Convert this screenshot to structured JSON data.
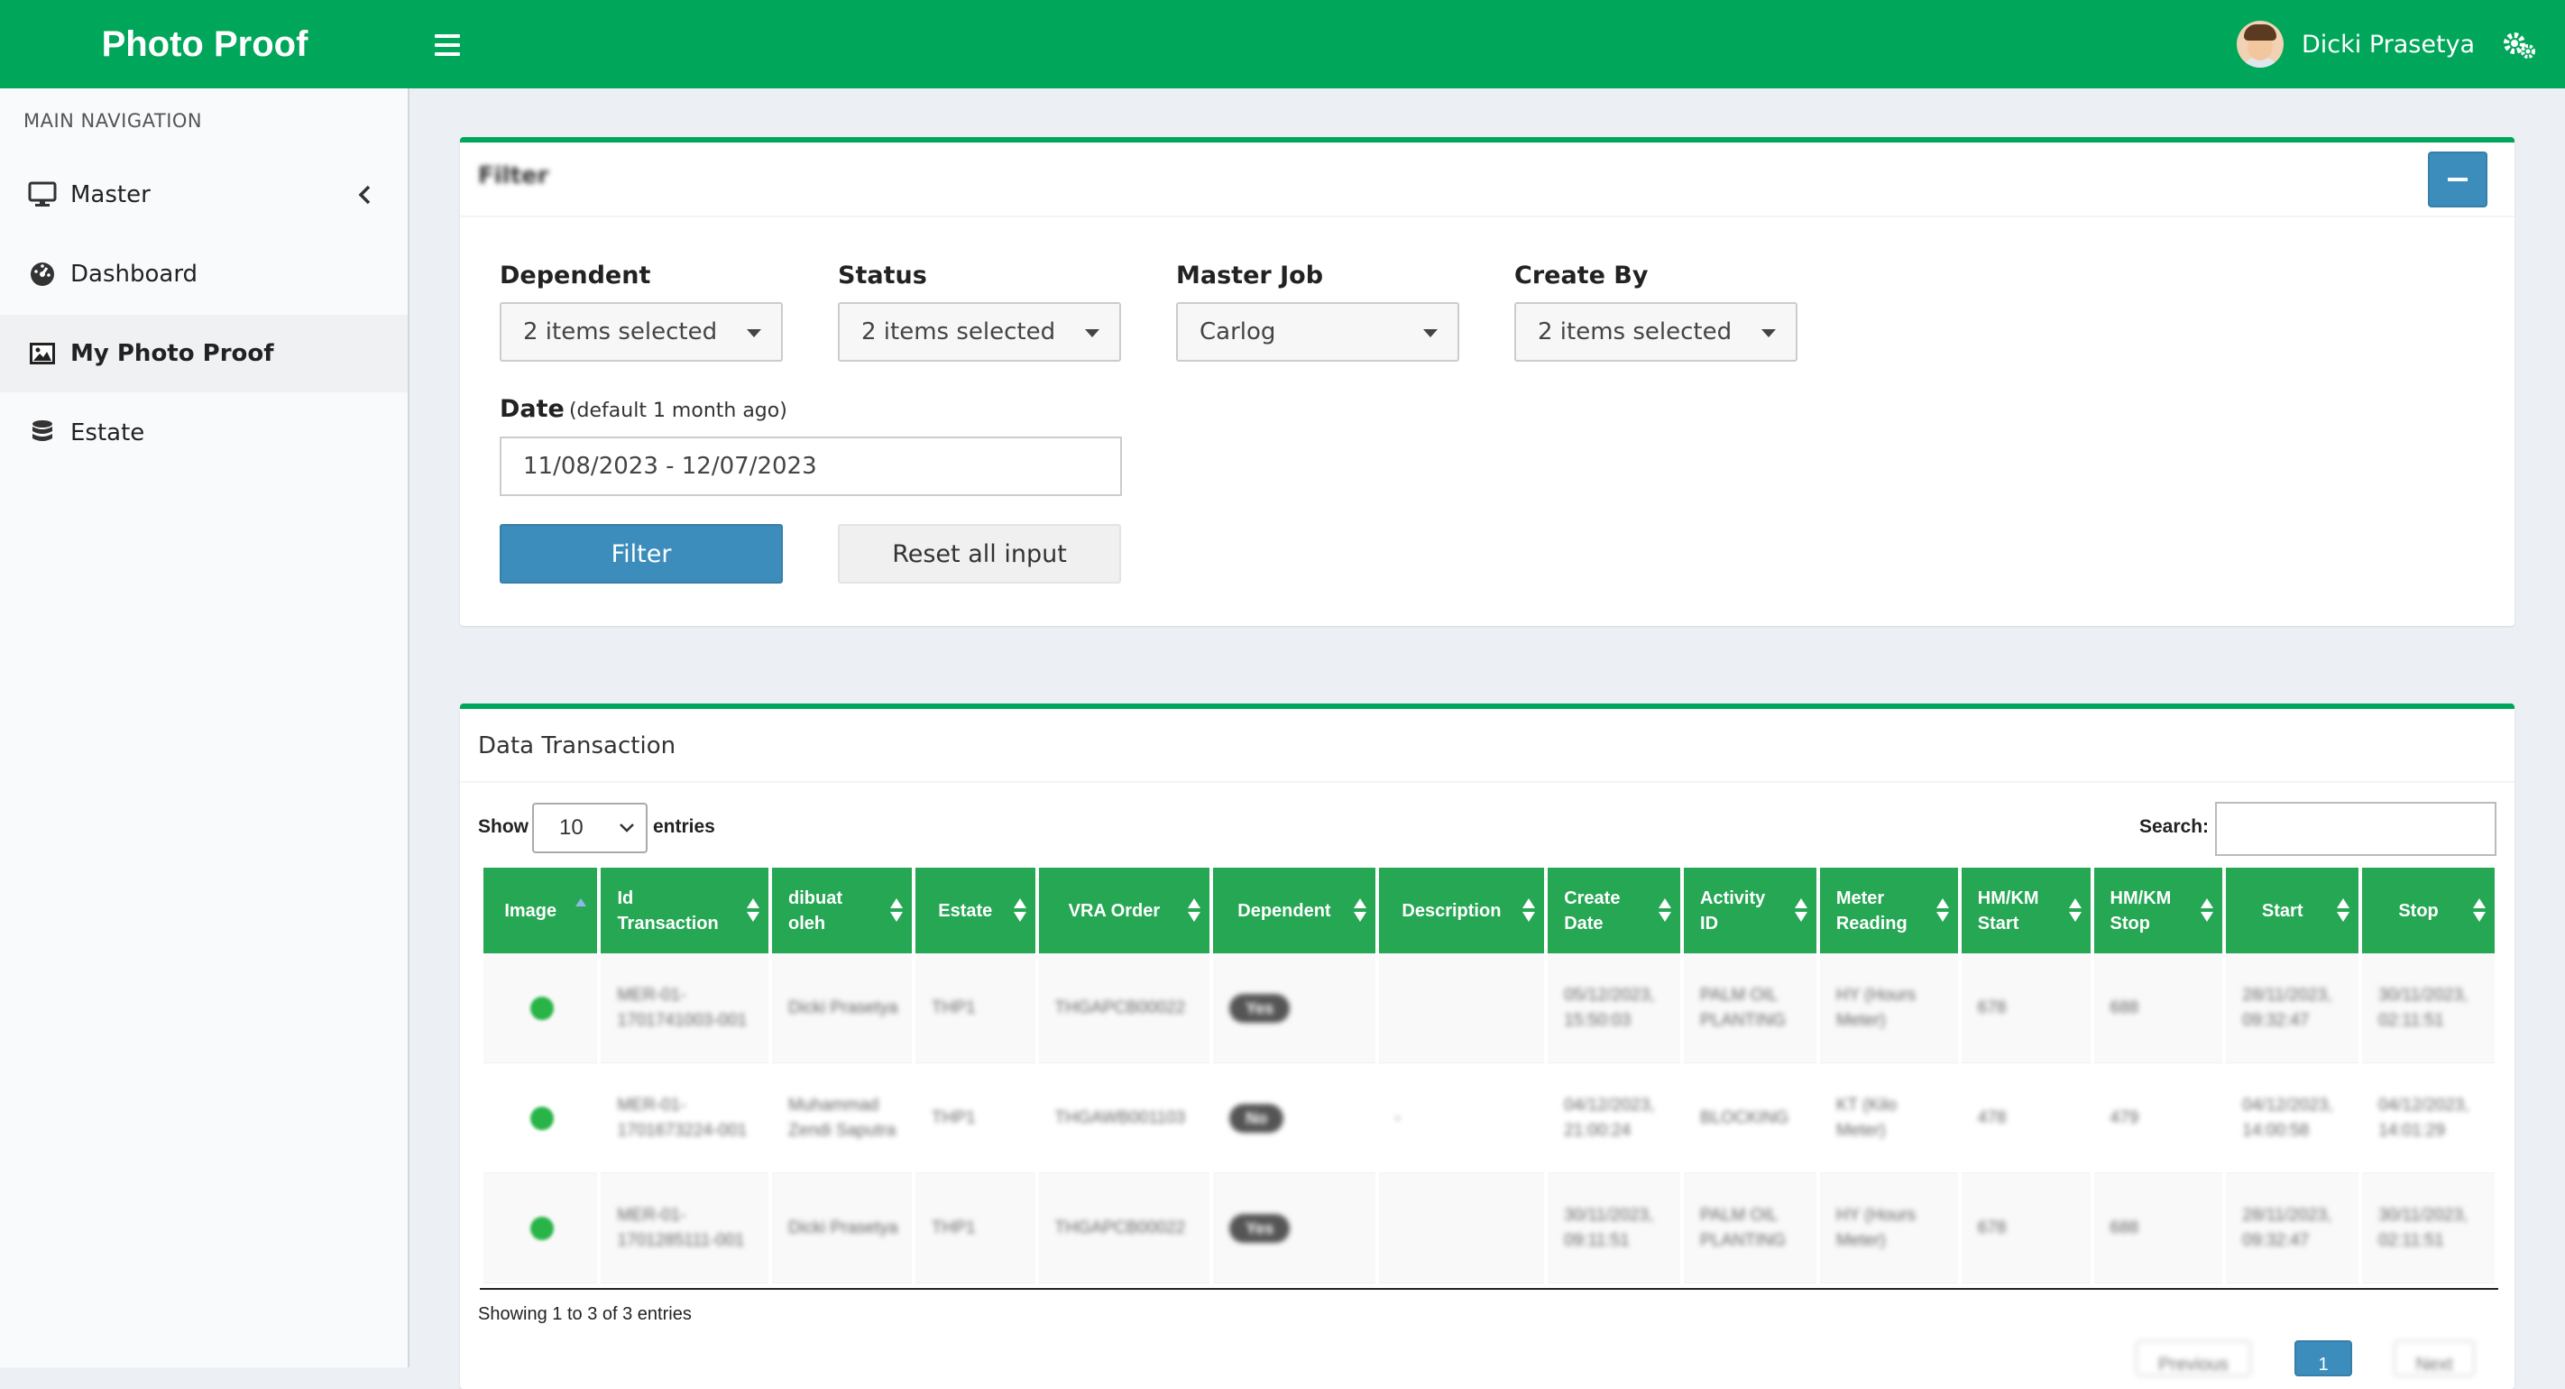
{
  "app": {
    "title": "Photo Proof"
  },
  "header": {
    "user_name": "Dicki Prasetya"
  },
  "sidebar": {
    "heading": "MAIN NAVIGATION",
    "items": [
      {
        "label": "Master",
        "icon": "monitor-icon"
      },
      {
        "label": "Dashboard",
        "icon": "dashboard-icon"
      },
      {
        "label": "My Photo Proof",
        "icon": "image-icon",
        "active": true
      },
      {
        "label": "Estate",
        "icon": "database-icon"
      }
    ]
  },
  "filter": {
    "title": "Filter",
    "dependent": {
      "label": "Dependent",
      "value": "2 items selected"
    },
    "status": {
      "label": "Status",
      "value": "2 items selected"
    },
    "master_job": {
      "label": "Master Job",
      "value": "Carlog"
    },
    "create_by": {
      "label": "Create By",
      "value": "2 items selected"
    },
    "date": {
      "label": "Date",
      "hint": "(default 1 month ago)",
      "value": "11/08/2023 - 12/07/2023"
    },
    "filter_button": "Filter",
    "reset_button": "Reset all input"
  },
  "transactions": {
    "title": "Data Transaction",
    "show_label": "Show",
    "entries_value": "10",
    "entries_label": "entries",
    "search_label": "Search:",
    "columns": [
      "Image",
      "Id Transaction",
      "dibuat oleh",
      "Estate",
      "VRA Order",
      "Dependent",
      "Description",
      "Create Date",
      "Activity ID",
      "Meter Reading",
      "HM/KM Start",
      "HM/KM Stop",
      "Start",
      "Stop"
    ],
    "rows": [
      {
        "id": "MER-01-1701741003-001",
        "by": "Dicki Prasetya",
        "estate": "THP1",
        "vra": "THGAPCB00022",
        "dependent": "Yes",
        "description": "",
        "create_date": "05/12/2023, 15:50:03",
        "activity": "PALM OIL PLANTING",
        "meter": "HY (Hours Meter)",
        "hm_start": "678",
        "hm_stop": "688",
        "start": "28/11/2023, 09:32:47",
        "stop": "30/11/2023, 02:11:51"
      },
      {
        "id": "MER-01-1701673224-001",
        "by": "Muhammad Zendi Saputra",
        "estate": "THP1",
        "vra": "THGAWB001103",
        "dependent": "No",
        "description": "-",
        "create_date": "04/12/2023, 21:00:24",
        "activity": "BLOCKING",
        "meter": "KT (Kilo Meter)",
        "hm_start": "478",
        "hm_stop": "479",
        "start": "04/12/2023, 14:00:58",
        "stop": "04/12/2023, 14:01:29"
      },
      {
        "id": "MER-01-1701285111-001",
        "by": "Dicki Prasetya",
        "estate": "THP1",
        "vra": "THGAPCB00022",
        "dependent": "Yes",
        "description": "",
        "create_date": "30/11/2023, 09:11:51",
        "activity": "PALM OIL PLANTING",
        "meter": "HY (Hours Meter)",
        "hm_start": "678",
        "hm_stop": "688",
        "start": "28/11/2023, 09:32:47",
        "stop": "30/11/2023, 02:11:51"
      }
    ],
    "info": "Showing 1 to 3 of 3 entries",
    "pagination": {
      "previous": "Previous",
      "current": "1",
      "next": "Next"
    }
  },
  "colors": {
    "brand": "#00a65a",
    "header_cell": "#25a754",
    "primary": "#3c8dbc"
  }
}
